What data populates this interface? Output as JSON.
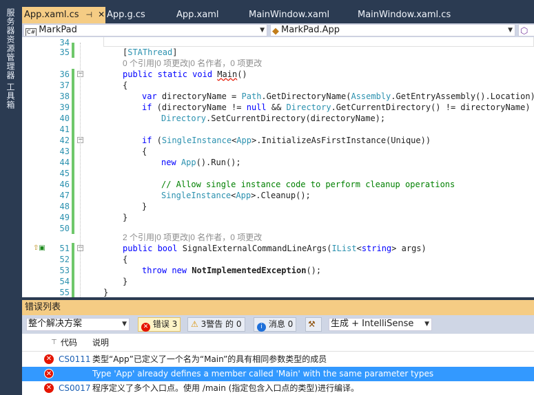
{
  "sidebar": {
    "tabs": [
      "服务器资源管理器",
      "工具箱"
    ]
  },
  "tabs": [
    {
      "label": "App.xaml.cs",
      "active": true
    },
    {
      "label": "App.g.cs",
      "active": false
    },
    {
      "label": "App.xaml",
      "active": false
    },
    {
      "label": "MainWindow.xaml",
      "active": false
    },
    {
      "label": "MainWindow.xaml.cs",
      "active": false
    }
  ],
  "nav": {
    "project": "MarkPad",
    "type": "MarkPad.App"
  },
  "code_lines": [
    {
      "n": "34",
      "text": ""
    },
    {
      "n": "35",
      "text": "[STAThread]"
    },
    {
      "n": "",
      "text": "0 个引用|0 项更改|0 名作者，0 项更改"
    },
    {
      "n": "36",
      "text": "public static void Main()"
    },
    {
      "n": "37",
      "text": "{"
    },
    {
      "n": "38",
      "text": "var directoryName = Path.GetDirectoryName(Assembly.GetEntryAssembly().Location);"
    },
    {
      "n": "39",
      "text": "if (directoryName != null && Directory.GetCurrentDirectory() != directoryName)"
    },
    {
      "n": "40",
      "text": "Directory.SetCurrentDirectory(directoryName);"
    },
    {
      "n": "41",
      "text": ""
    },
    {
      "n": "42",
      "text": "if (SingleInstance<App>.InitializeAsFirstInstance(Unique))"
    },
    {
      "n": "43",
      "text": "{"
    },
    {
      "n": "44",
      "text": "new App().Run();"
    },
    {
      "n": "45",
      "text": ""
    },
    {
      "n": "46",
      "text": "// Allow single instance code to perform cleanup operations"
    },
    {
      "n": "47",
      "text": "SingleInstance<App>.Cleanup();"
    },
    {
      "n": "48",
      "text": "}"
    },
    {
      "n": "49",
      "text": "}"
    },
    {
      "n": "50",
      "text": ""
    },
    {
      "n": "",
      "text": "2 个引用|0 项更改|0 名作者，0 项更改"
    },
    {
      "n": "51",
      "text": "public bool SignalExternalCommandLineArgs(IList<string> args)"
    },
    {
      "n": "52",
      "text": "{"
    },
    {
      "n": "53",
      "text": "throw new NotImplementedException();"
    },
    {
      "n": "54",
      "text": "}"
    },
    {
      "n": "55",
      "text": "}"
    }
  ],
  "errors_panel": {
    "title": "错误列表",
    "scope": "整个解决方案",
    "errors_btn": "错误 3",
    "warnings_btn": "3警告 的 0",
    "messages_btn": "消息 0",
    "build_filter": "生成 + IntelliSense",
    "col_code": "代码",
    "col_desc": "说明",
    "rows": [
      {
        "code": "CS0111",
        "desc": "类型“App”已定义了一个名为“Main”的具有相同参数类型的成员"
      },
      {
        "code": "",
        "desc": "Type 'App' already defines a member called 'Main' with the same parameter types"
      },
      {
        "code": "CS0017",
        "desc": "程序定义了多个入口点。使用 /main (指定包含入口点的类型)进行编译。"
      }
    ]
  }
}
